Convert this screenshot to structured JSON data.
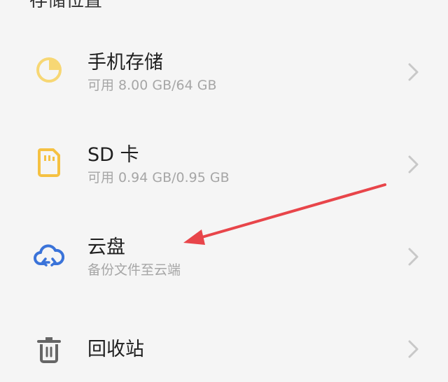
{
  "section": {
    "title": "存储位置"
  },
  "storage_items": [
    {
      "name": "phone-storage",
      "icon": "pie-chart-icon",
      "label": "手机存储",
      "subtitle": "可用 8.00 GB/64 GB",
      "icon_color": "#f7d774"
    },
    {
      "name": "sd-card",
      "icon": "sd-card-icon",
      "label": "SD 卡",
      "subtitle": "可用 0.94 GB/0.95 GB",
      "icon_color": "#f5c142"
    },
    {
      "name": "cloud-drive",
      "icon": "cloud-sync-icon",
      "label": "云盘",
      "subtitle": "备份文件至云端",
      "icon_color": "#3a73d9"
    },
    {
      "name": "recycle-bin",
      "icon": "trash-icon",
      "label": "回收站",
      "subtitle": "",
      "icon_color": "#666666"
    }
  ],
  "colors": {
    "background": "#f5f5f5",
    "title_text": "#1f1f1f",
    "subtitle_text": "#a6a6a6",
    "chevron": "#c8c8c8",
    "annotation_arrow": "#e8454a"
  },
  "annotation": {
    "icon": "red-arrow-pointing-to-cloud-drive"
  }
}
